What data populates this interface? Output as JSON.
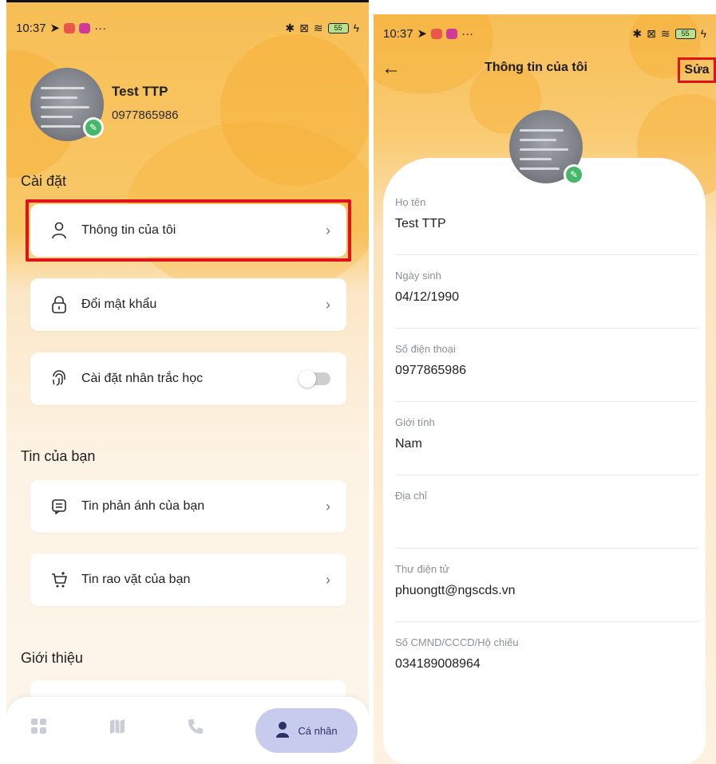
{
  "left": {
    "status": {
      "time": "10:37",
      "dots": "···",
      "battery": "55"
    },
    "profile": {
      "name": "Test TTP",
      "phone": "0977865986"
    },
    "settings_title": "Cài đặt",
    "settings_items": [
      {
        "label": "Thông tin của tôi",
        "icon": "user-icon"
      },
      {
        "label": "Đổi mật khẩu",
        "icon": "lock-icon"
      },
      {
        "label": "Cài đặt nhân trắc học",
        "icon": "fingerprint-icon",
        "toggle": false
      }
    ],
    "news_title": "Tin của bạn",
    "news_items": [
      {
        "label": "Tin phản ánh của bạn",
        "icon": "message-icon"
      },
      {
        "label": "Tin rao vặt của bạn",
        "icon": "cart-icon"
      }
    ],
    "intro_title": "Giới thiệu",
    "nav": {
      "active_label": "Cá nhân",
      "items": [
        "grid-icon",
        "map-icon",
        "phone-icon",
        "person-icon"
      ]
    },
    "colors": {
      "highlight": "#e0121b",
      "accent": "#f7be55",
      "nav_active_bg": "#c7ccef"
    }
  },
  "right": {
    "status": {
      "time": "10:37",
      "dots": "···",
      "battery": "55"
    },
    "header": {
      "title": "Thông tin của tôi",
      "edit_label": "Sửa"
    },
    "fields": [
      {
        "label": "Họ tên",
        "value": "Test TTP"
      },
      {
        "label": "Ngày sinh",
        "value": "04/12/1990"
      },
      {
        "label": "Số điện thoại",
        "value": "0977865986"
      },
      {
        "label": "Giới tính",
        "value": "Nam"
      },
      {
        "label": "Địa chỉ",
        "value": ""
      },
      {
        "label": "Thư điện tử",
        "value": "phuongtt@ngscds.vn"
      },
      {
        "label": "Số CMND/CCCD/Hộ chiếu",
        "value": "034189008964"
      }
    ]
  }
}
